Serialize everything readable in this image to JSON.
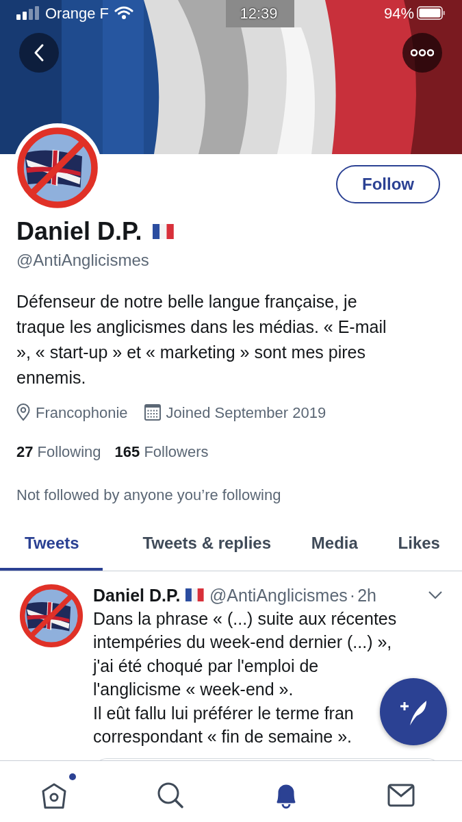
{
  "status_bar": {
    "carrier": "Orange F",
    "time": "12:39",
    "battery": "94%"
  },
  "follow_button": {
    "label": "Follow"
  },
  "profile": {
    "name": "Daniel D.P.",
    "handle": "@AntiAnglicismes",
    "bio": "Défenseur de notre belle langue française, je traque les anglicismes dans les médias. « E-mail », « start-up » et « marketing » sont mes pires ennemis.",
    "location": "Francophonie",
    "joined": "Joined September 2019",
    "following_count": "27",
    "following_label": "Following",
    "followers_count": "165",
    "followers_label": "Followers",
    "follow_context": "Not followed by anyone you’re following"
  },
  "tabs": [
    {
      "label": "Tweets",
      "selected": true
    },
    {
      "label": "Tweets & replies",
      "selected": false
    },
    {
      "label": "Media",
      "selected": false
    },
    {
      "label": "Likes",
      "selected": false
    }
  ],
  "tweets": [
    {
      "name": "Daniel D.P.",
      "handle": "@AntiAnglicismes",
      "separator": "·",
      "time": "2h",
      "text_lines": [
        "Dans la phrase « (...) suite aux récentes",
        "intempéries du week-end dernier (...) »,",
        "j'ai été choqué par l'emploi de",
        "l'anglicisme « week-end ».",
        "Il eût fallu lui préférer le terme fran",
        "correspondant « fin de semaine »."
      ]
    }
  ],
  "bottom_nav": [
    {
      "kind": "home",
      "selected": false,
      "badge": true
    },
    {
      "kind": "search",
      "selected": false,
      "badge": false
    },
    {
      "kind": "notifications",
      "selected": true,
      "badge": false
    },
    {
      "kind": "messages",
      "selected": false,
      "badge": false
    }
  ]
}
